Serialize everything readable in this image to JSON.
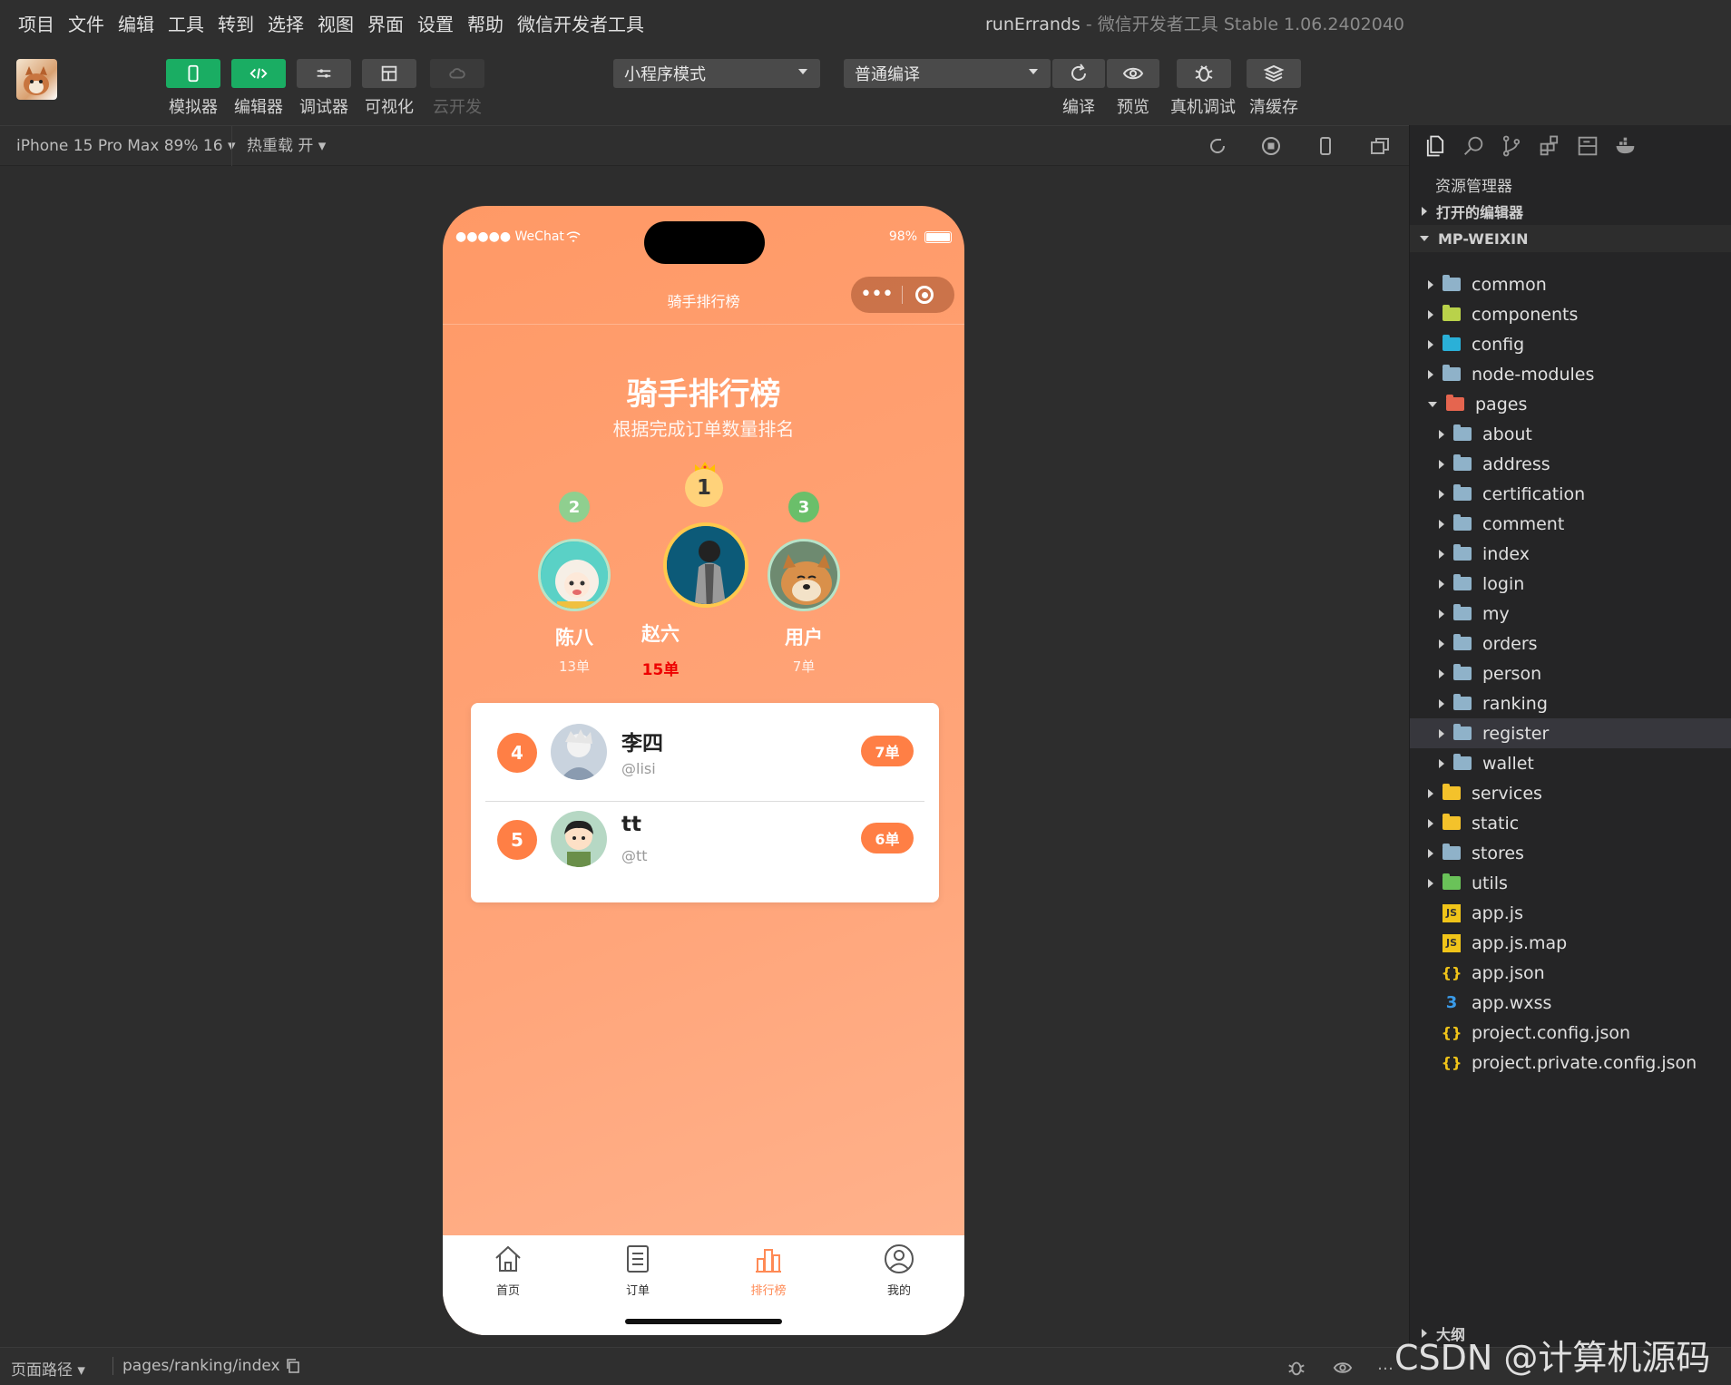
{
  "menu": {
    "items": [
      "项目",
      "文件",
      "编辑",
      "工具",
      "转到",
      "选择",
      "视图",
      "界面",
      "设置",
      "帮助",
      "微信开发者工具"
    ]
  },
  "window_title": {
    "project": "runErrands",
    "sep": " - ",
    "app": "微信开发者工具 Stable 1.06.2402040"
  },
  "toolbar": {
    "simulator": "模拟器",
    "editor": "编辑器",
    "debugger": "调试器",
    "visual": "可视化",
    "cloud": "云开发",
    "mode_select": "小程序模式",
    "compile_select": "普通编译",
    "compile": "编译",
    "preview": "预览",
    "remote_debug": "真机调试",
    "clear_cache": "清缓存"
  },
  "subbar": {
    "device": "iPhone 15 Pro Max 89% 16 ▾",
    "hot_reload": "热重载 开 ▾"
  },
  "phone": {
    "status_left": "●●●●● WeChat",
    "battery": "98%",
    "nav_title": "骑手排行榜",
    "page_title": "骑手排行榜",
    "page_subtitle": "根据完成订单数量排名",
    "podium": [
      {
        "rank": "2",
        "name": "陈八",
        "count": "13单"
      },
      {
        "rank": "1",
        "name": "赵六",
        "count": "15单"
      },
      {
        "rank": "3",
        "name": "用户",
        "count": "7单"
      }
    ],
    "list": [
      {
        "rank": "4",
        "name": "李四",
        "handle": "@lisi",
        "count": "7单"
      },
      {
        "rank": "5",
        "name": "tt",
        "handle": "@tt",
        "count": "6单"
      }
    ],
    "tabs": [
      {
        "label": "首页",
        "icon": "home-icon"
      },
      {
        "label": "订单",
        "icon": "order-icon"
      },
      {
        "label": "排行榜",
        "icon": "ranking-icon",
        "active": true
      },
      {
        "label": "我的",
        "icon": "user-icon"
      }
    ],
    "accent": "#ff7f45"
  },
  "explorer": {
    "title": "资源管理器",
    "open_editors": "打开的编辑器",
    "root": "MP-WEIXIN",
    "tree": [
      {
        "name": "common"
      },
      {
        "name": "components"
      },
      {
        "name": "config"
      },
      {
        "name": "node-modules"
      },
      {
        "name": "pages"
      },
      {
        "name": "about"
      },
      {
        "name": "address"
      },
      {
        "name": "certification"
      },
      {
        "name": "comment"
      },
      {
        "name": "index"
      },
      {
        "name": "login"
      },
      {
        "name": "my"
      },
      {
        "name": "orders"
      },
      {
        "name": "person"
      },
      {
        "name": "ranking"
      },
      {
        "name": "register"
      },
      {
        "name": "wallet"
      },
      {
        "name": "services"
      },
      {
        "name": "static"
      },
      {
        "name": "stores"
      },
      {
        "name": "utils"
      },
      {
        "name": "app.js"
      },
      {
        "name": "app.js.map"
      },
      {
        "name": "app.json"
      },
      {
        "name": "app.wxss"
      },
      {
        "name": "project.config.json"
      },
      {
        "name": "project.private.config.json"
      }
    ],
    "outline": "大纲"
  },
  "statusbar": {
    "path_label": "页面路径 ▾",
    "path": "pages/ranking/index"
  },
  "watermark": "CSDN @计算机源码站"
}
